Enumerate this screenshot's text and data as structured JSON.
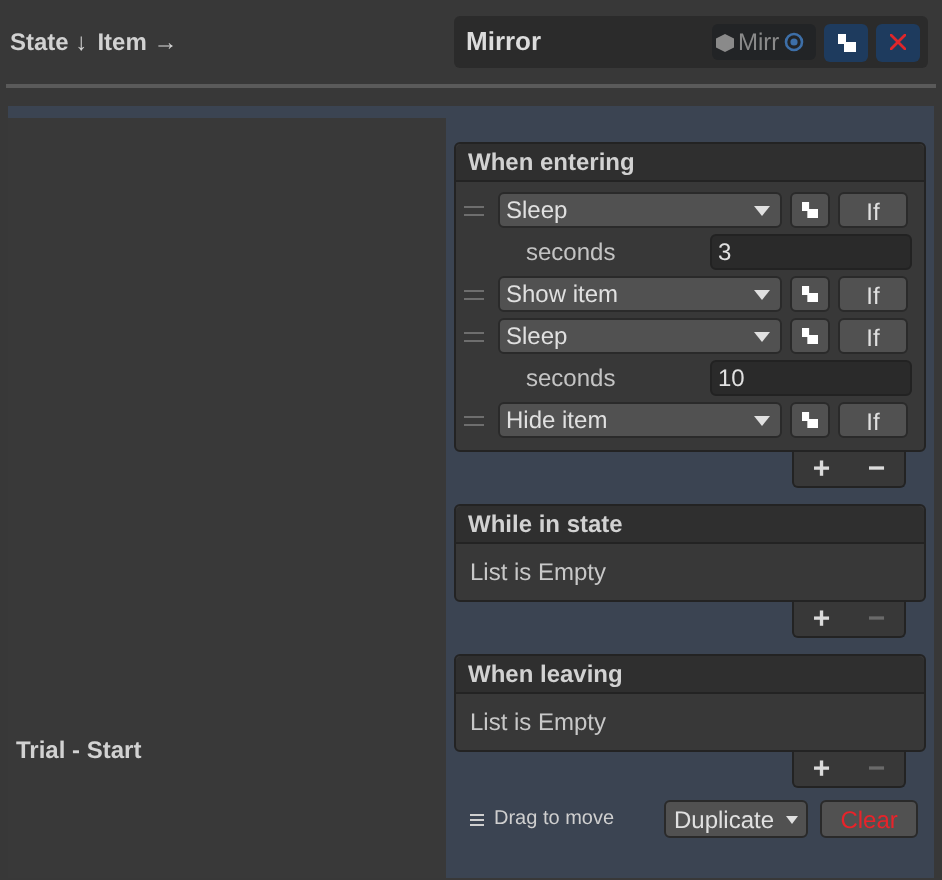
{
  "header": {
    "state_label": "State ↓",
    "item_label": "Item →"
  },
  "item": {
    "name": "Mirror",
    "object_field": "Mirr"
  },
  "row_label": "Trial - Start",
  "sections": [
    {
      "title": "When entering",
      "add_label": "+",
      "remove_label": "−",
      "remove_disabled": false,
      "items": [
        {
          "action": "Sleep",
          "condition": "If",
          "params": [
            {
              "label": "seconds",
              "value": "3"
            }
          ]
        },
        {
          "action": "Show item",
          "condition": "If"
        },
        {
          "action": "Sleep",
          "condition": "If",
          "params": [
            {
              "label": "seconds",
              "value": "10"
            }
          ]
        },
        {
          "action": "Hide item",
          "condition": "If"
        }
      ]
    },
    {
      "title": "While in state",
      "add_label": "+",
      "remove_label": "−",
      "remove_disabled": true,
      "empty_text": "List is Empty"
    },
    {
      "title": "When leaving",
      "add_label": "+",
      "remove_label": "−",
      "remove_disabled": true,
      "empty_text": "List is Empty"
    }
  ],
  "footer": {
    "drag_hint": "Drag to move",
    "duplicate": "Duplicate",
    "clear": "Clear"
  }
}
